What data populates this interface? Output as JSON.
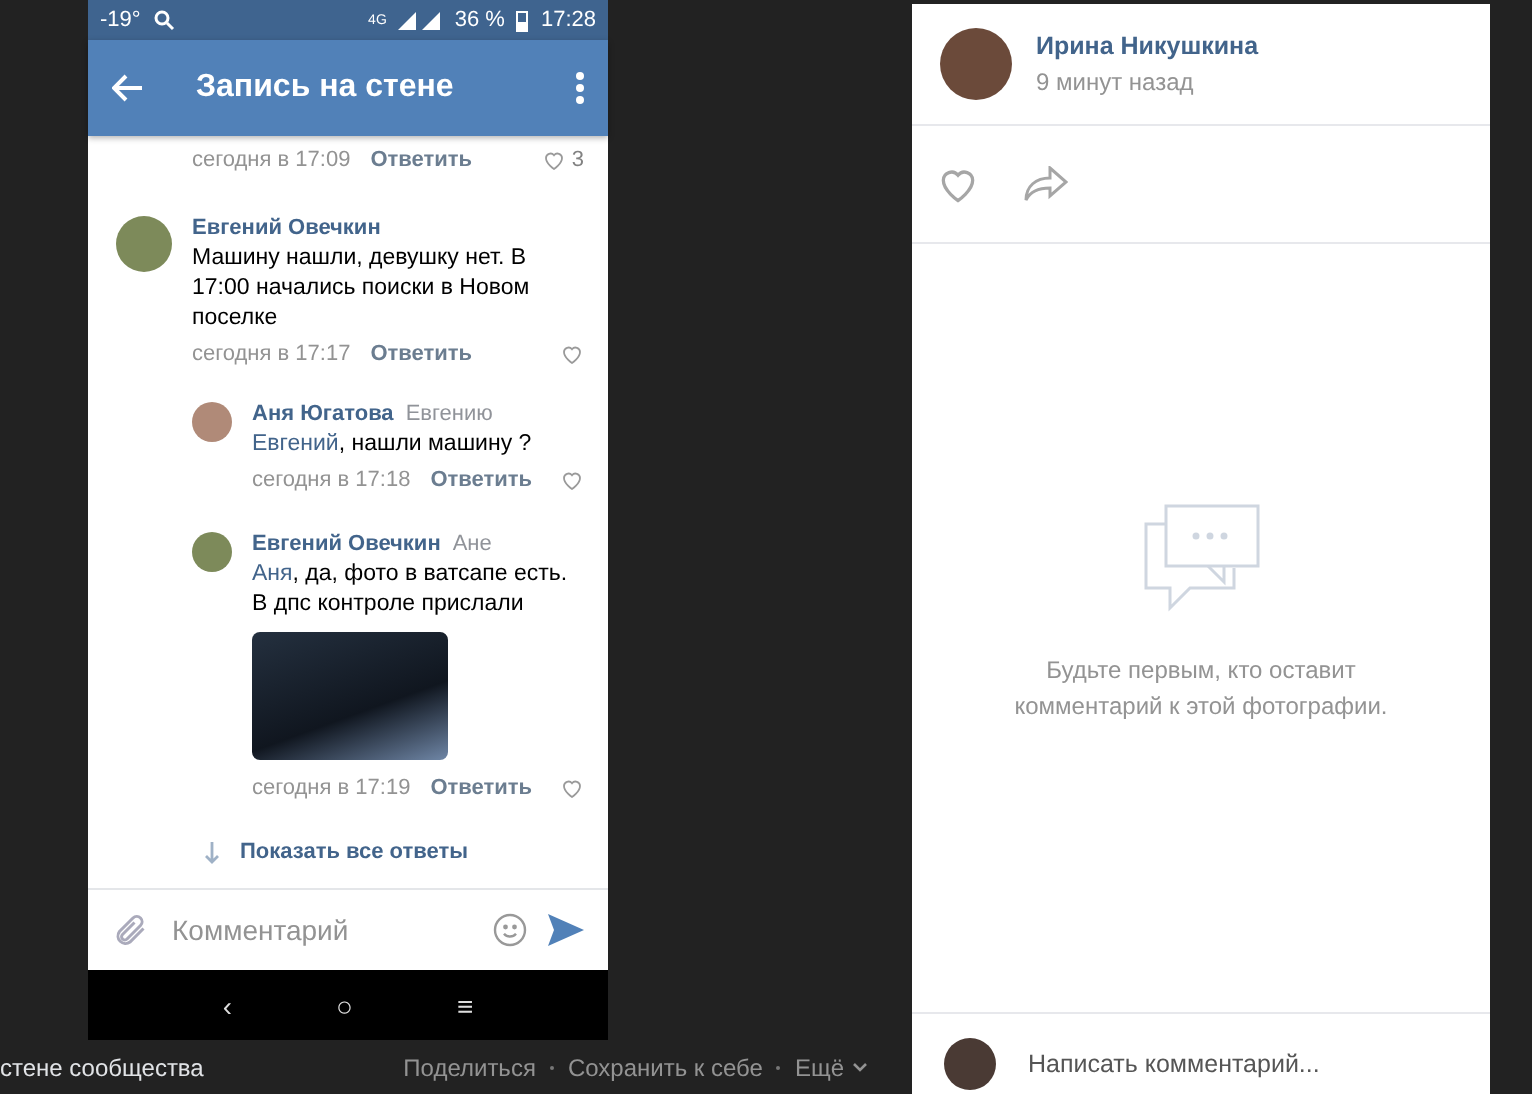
{
  "phone": {
    "status_bar": {
      "temperature": "-19°",
      "network": "4G",
      "battery": "36 %",
      "time": "17:28"
    },
    "toolbar": {
      "title": "Запись на стене"
    },
    "comments": [
      {
        "kind": "meta",
        "time": "сегодня в 17:09",
        "reply": "Ответить",
        "likes": "3"
      },
      {
        "kind": "comment",
        "author": "Евгений Овечкин",
        "text": "Машину нашли, девушку нет. В 17:00 начались поиски в Новом поселке",
        "time": "сегодня в 17:17",
        "reply": "Ответить"
      },
      {
        "kind": "reply",
        "author": "Аня Югатова",
        "addressee": "Евгению",
        "mention": "Евгений",
        "text": ", нашли машину ?",
        "time": "сегодня в 17:18",
        "reply": "Ответить"
      },
      {
        "kind": "reply",
        "author": "Евгений Овечкин",
        "addressee": "Ане",
        "mention": "Аня",
        "text": ", да, фото в ватсапе есть. В дпс контроле прислали",
        "photo": true,
        "time": "сегодня в 17:19",
        "reply": "Ответить"
      }
    ],
    "show_all": "Показать все ответы",
    "input": {
      "placeholder": "Комментарий"
    },
    "nav_keys": [
      "‹",
      "○",
      "≡"
    ]
  },
  "caption": {
    "text": "стене сообщества",
    "links": [
      "Поделиться",
      "Сохранить к себе",
      "Ещё"
    ]
  },
  "post_panel": {
    "author": "Ирина Никушкина",
    "time": "9 минут назад",
    "empty_text": "Будьте первым, кто оставит комментарий к этой фотографии.",
    "comment_input": {
      "placeholder": "Написать комментарий..."
    }
  }
}
